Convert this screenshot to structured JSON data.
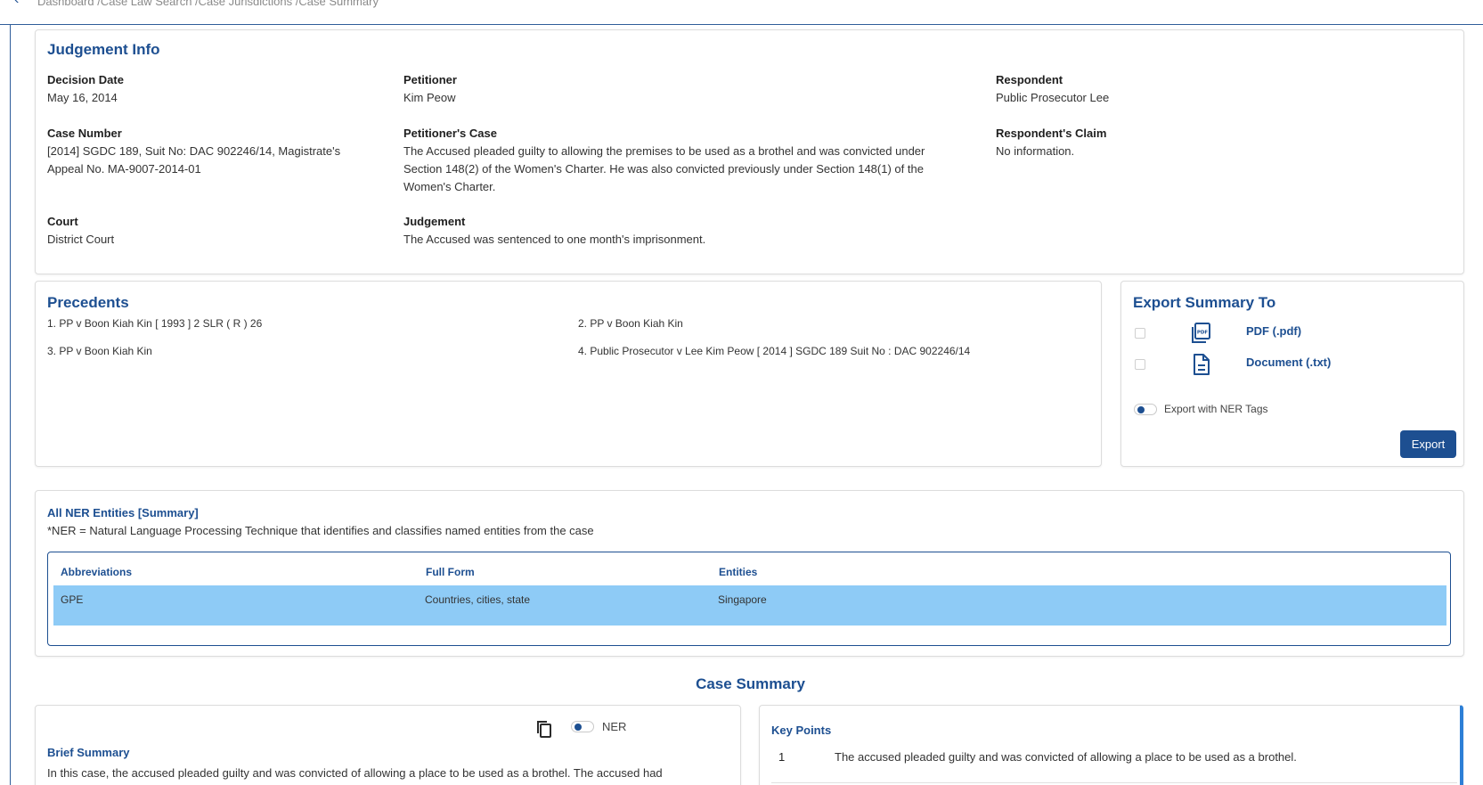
{
  "breadcrumb": {
    "back_icon": "chevron-left-icon",
    "text": "Dashboard /Case Law Search /Case Jurisdictions /Case Summary"
  },
  "judgement_info": {
    "title": "Judgement Info",
    "decision_date": {
      "label": "Decision Date",
      "value": "May 16, 2014"
    },
    "petitioner": {
      "label": "Petitioner",
      "value": "Kim Peow"
    },
    "respondent": {
      "label": "Respondent",
      "value": "Public Prosecutor Lee"
    },
    "case_number": {
      "label": "Case Number",
      "line1": "[2014] SGDC 189, Suit No: DAC 902246/14, Magistrate's",
      "line2": "Appeal No. MA-9007-2014-01"
    },
    "petitioners_case": {
      "label": "Petitioner's Case",
      "line1": "The Accused pleaded guilty to allowing the premises to be used as a brothel and was convicted under",
      "line2": "Section 148(2) of the Women's Charter. He was also convicted previously under Section 148(1) of the",
      "line3": "Women's Charter."
    },
    "respondents_claim": {
      "label": "Respondent's Claim",
      "value": "No information."
    },
    "court": {
      "label": "Court",
      "value": "District Court"
    },
    "judgement": {
      "label": "Judgement",
      "value": "The Accused was sentenced to one month's imprisonment."
    }
  },
  "precedents": {
    "title": "Precedents",
    "items": [
      "1. PP v Boon Kiah Kin [ 1993 ] 2 SLR ( R ) 26",
      "2. PP v Boon Kiah Kin",
      "3. PP v Boon Kiah Kin",
      "4. Public Prosecutor v Lee Kim Peow [ 2014 ] SGDC 189 Suit No : DAC 902246/14"
    ]
  },
  "export": {
    "title": "Export Summary To",
    "options": [
      {
        "label": "PDF (.pdf)",
        "icon": "pdf-file-icon",
        "checked": false
      },
      {
        "label": "Document (.txt)",
        "icon": "document-icon",
        "checked": false
      }
    ],
    "ner_toggle_label": "Export with NER Tags",
    "button_label": "Export",
    "accent": "#1d4f91"
  },
  "ner": {
    "title": "All NER Entities [Summary]",
    "note": "*NER = Natural Language Processing Technique that identifies and classifies named entities from the case",
    "headers": [
      "Abbreviations",
      "Full Form",
      "Entities"
    ],
    "rows": [
      [
        "GPE",
        "Countries, cities, state",
        "Singapore"
      ]
    ],
    "row_color": "#8ecbf6"
  },
  "case_summary": {
    "title": "Case Summary",
    "copy_icon": "copy-icon",
    "ner_toggle_label": "NER",
    "brief_title": "Brief Summary",
    "brief_text": "In this case, the accused pleaded guilty and was convicted of allowing a place to be used as a brothel. The accused had",
    "key_points_title": "Key Points",
    "key_points": [
      {
        "num": "1",
        "text": "The accused pleaded guilty and was convicted of allowing a place to be used as a brothel."
      }
    ]
  }
}
